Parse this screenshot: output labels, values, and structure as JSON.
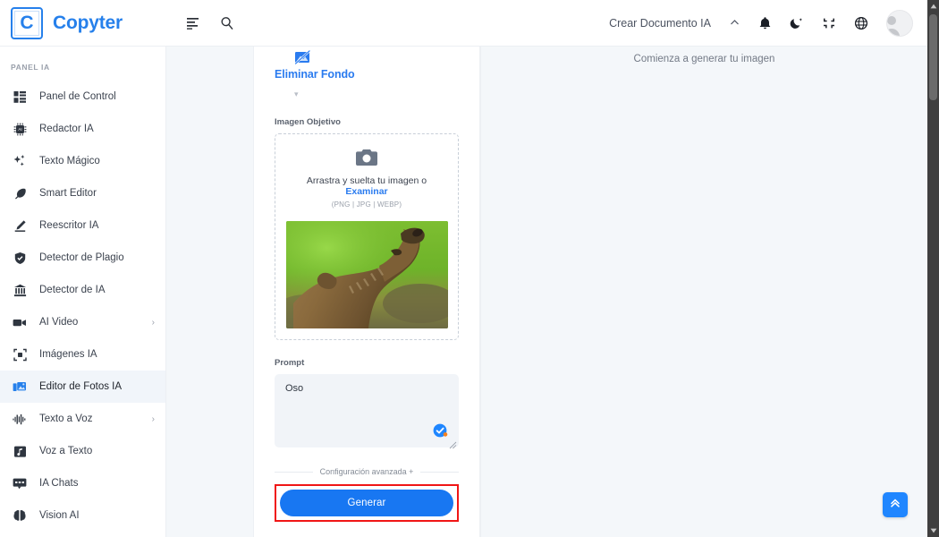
{
  "header": {
    "brand_initial": "C",
    "brand_name": "Copyter",
    "menu_icon": "menu-lines-icon",
    "search_icon": "search-icon",
    "create_doc_label": "Crear Documento IA",
    "chevron_icon": "chevron-up-icon",
    "bell_icon": "bell-icon",
    "theme_icon": "moon-icon",
    "fullscreen_icon": "compress-icon",
    "language_icon": "globe-icon",
    "avatar_icon": "user-avatar"
  },
  "sidebar": {
    "section_label": "PANEL IA",
    "items": [
      {
        "label": "Panel de Control",
        "icon": "dashboard-icon",
        "active": false,
        "caret": ""
      },
      {
        "label": "Redactor IA",
        "icon": "chip-ai-icon",
        "active": false,
        "caret": ""
      },
      {
        "label": "Texto Mágico",
        "icon": "sparkles-icon",
        "active": false,
        "caret": ""
      },
      {
        "label": "Smart Editor",
        "icon": "feather-icon",
        "active": false,
        "caret": ""
      },
      {
        "label": "Reescritor IA",
        "icon": "pencil-icon",
        "active": false,
        "caret": ""
      },
      {
        "label": "Detector de Plagio",
        "icon": "shield-check-icon",
        "active": false,
        "caret": ""
      },
      {
        "label": "Detector de IA",
        "icon": "bank-icon",
        "active": false,
        "caret": ""
      },
      {
        "label": "AI Video",
        "icon": "video-camera-icon",
        "active": false,
        "caret": "›"
      },
      {
        "label": "Imágenes IA",
        "icon": "image-frame-icon",
        "active": false,
        "caret": ""
      },
      {
        "label": "Editor de Fotos IA",
        "icon": "photo-edit-icon",
        "active": true,
        "caret": ""
      },
      {
        "label": "Texto a Voz",
        "icon": "waveform-icon",
        "active": false,
        "caret": "›"
      },
      {
        "label": "Voz a Texto",
        "icon": "music-note-icon",
        "active": false,
        "caret": ""
      },
      {
        "label": "IA Chats",
        "icon": "chat-icon",
        "active": false,
        "caret": ""
      },
      {
        "label": "Vision AI",
        "icon": "brain-icon",
        "active": false,
        "caret": ""
      }
    ]
  },
  "form": {
    "mode_icon": "remove-background-icon",
    "mode_title": "Eliminar Fondo",
    "mode_caret": "▾",
    "target_image_label": "Imagen Objetivo",
    "dropzone": {
      "camera_icon": "camera-icon",
      "text_before": "Arrastra y suelta tu imagen o ",
      "browse_link": "Examinar",
      "formats": "(PNG | JPG | WEBP)"
    },
    "thumbnail_alt": "oso-marron-foto",
    "prompt_label": "Prompt",
    "prompt_value": "Oso",
    "prompt_placeholder": "Prompt",
    "grammar_badge_icon": "grammarly-check-icon",
    "advanced_label": "Configuración avanzada +",
    "generate_label": "Generar",
    "highlight_color": "#f01616",
    "accent_color": "#1877f2"
  },
  "result": {
    "hint": "Comienza a generar tu imagen",
    "scroll_top_icon": "chevron-double-up-icon"
  }
}
